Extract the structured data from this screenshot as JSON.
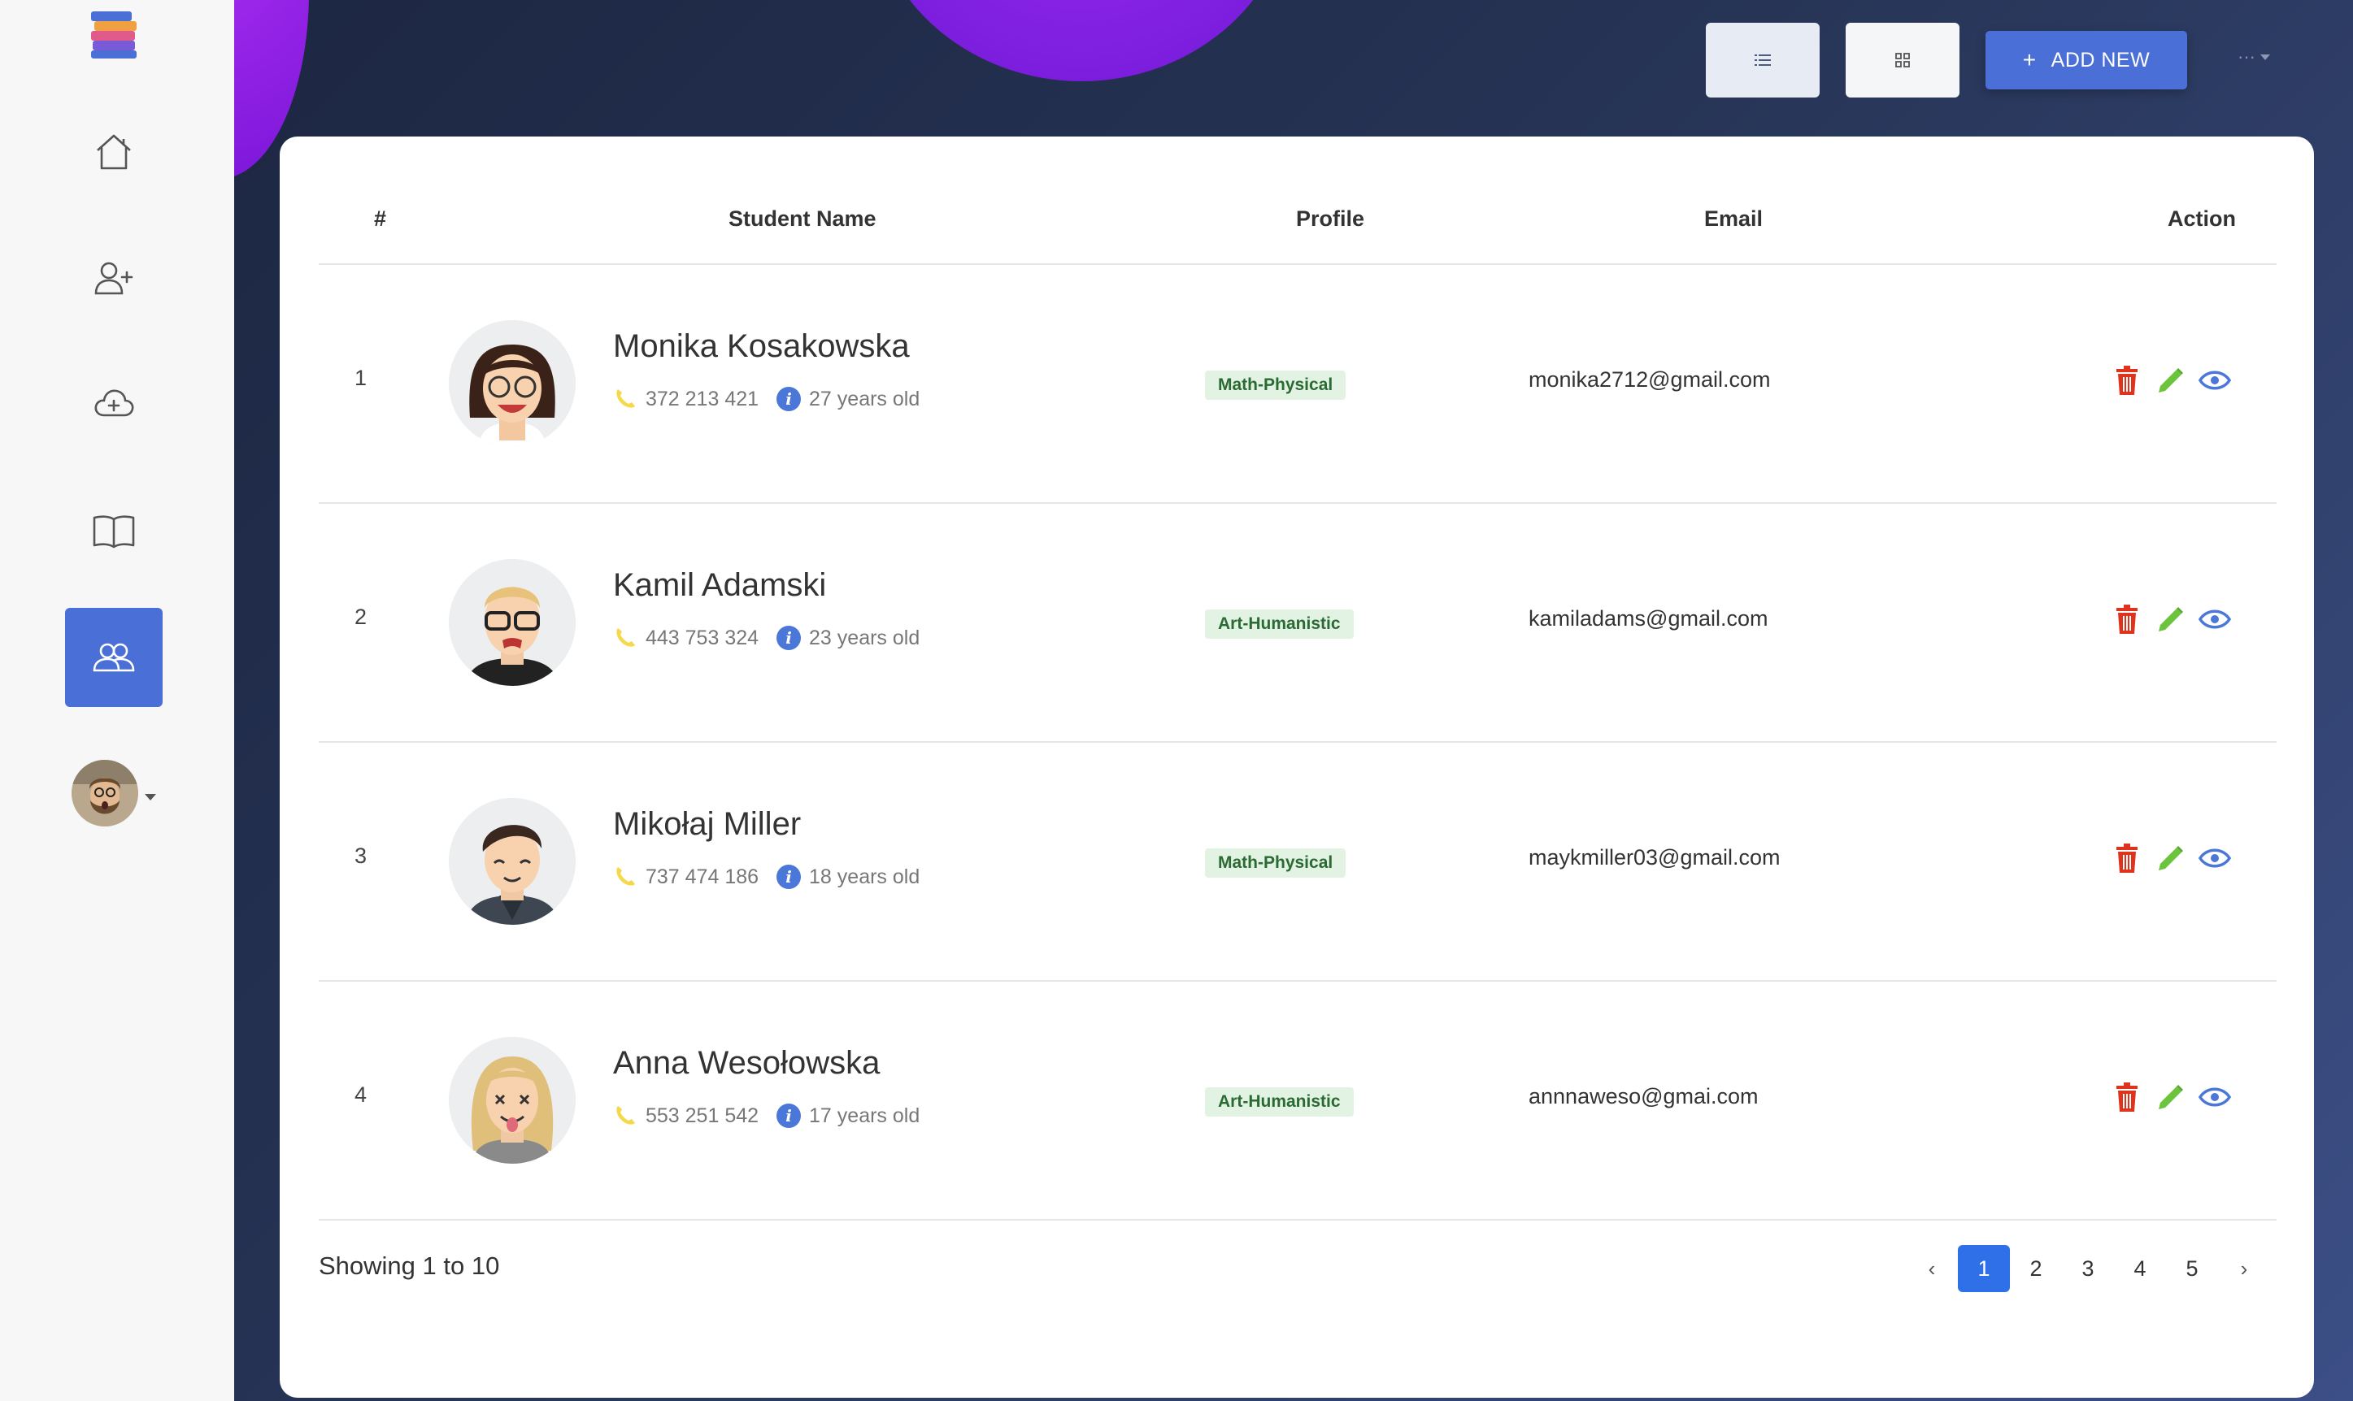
{
  "colors": {
    "accent": "#4a6fd6",
    "pager_active": "#2f6fe8",
    "badge_bg": "#e2f3e4",
    "badge_text": "#2b6a33",
    "delete": "#e0331e",
    "edit": "#6cc43d",
    "view": "#4a77d8"
  },
  "sidebar": {
    "items": [
      {
        "icon": "home-icon"
      },
      {
        "icon": "add-user-icon"
      },
      {
        "icon": "cloud-upload-icon"
      },
      {
        "icon": "book-icon"
      },
      {
        "icon": "users-icon",
        "active": true
      }
    ],
    "avatar_icon": "user-avatar"
  },
  "toolbar": {
    "list_view_icon": "list-icon",
    "grid_view_icon": "grid-icon",
    "add_label": "ADD NEW",
    "add_prefix": "+",
    "more_label": "···"
  },
  "table": {
    "headers": {
      "index": "#",
      "name": "Student Name",
      "profile": "Profile",
      "email": "Email",
      "action": "Action"
    },
    "rows": [
      {
        "index": "1",
        "name": "Monika Kosakowska",
        "phone": "372 213 421",
        "age": "27 years old",
        "profile": "Math-Physical",
        "email": "monika2712@gmail.com"
      },
      {
        "index": "2",
        "name": "Kamil Adamski",
        "phone": "443 753 324",
        "age": "23 years old",
        "profile": "Art-Humanistic",
        "email": "kamiladams@gmail.com"
      },
      {
        "index": "3",
        "name": "Mikołaj Miller",
        "phone": "737 474 186",
        "age": "18 years old",
        "profile": "Math-Physical",
        "email": "maykmiller03@gmail.com"
      },
      {
        "index": "4",
        "name": "Anna Wesołowska",
        "phone": "553 251 542",
        "age": "17 years old",
        "profile": "Art-Humanistic",
        "email": "annnaweso@gmai.com"
      }
    ]
  },
  "footer": {
    "showing": "Showing 1 to 10",
    "pages": [
      "1",
      "2",
      "3",
      "4",
      "5"
    ],
    "current_page": "1",
    "prev": "‹",
    "next": "›"
  }
}
